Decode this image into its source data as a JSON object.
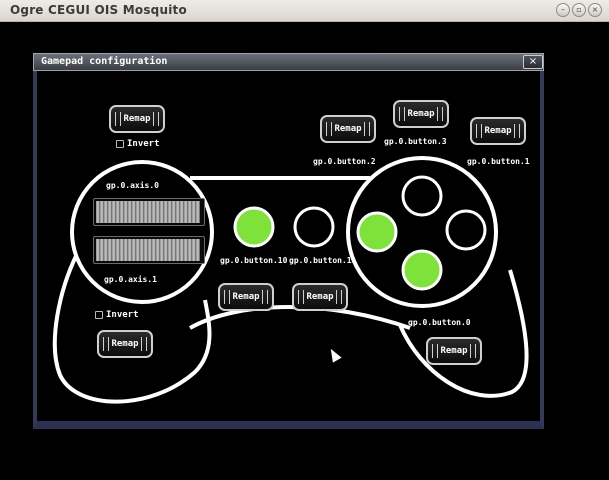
{
  "window": {
    "title": "Ogre CEGUI OIS Mosquito",
    "controls": {
      "minimize": "–",
      "maximize": "▫",
      "close": "×"
    }
  },
  "dialog": {
    "title": "Gamepad configuration",
    "close_icon": "×"
  },
  "remap_label": "Remap",
  "invert_label": "Invert",
  "axes": [
    {
      "label": "gp.0.axis.0",
      "level": 0.98
    },
    {
      "label": "gp.0.axis.1",
      "level": 0.98
    }
  ],
  "buttons": {
    "b0": "gp.0.button.0",
    "b1": "gp.0.button.1",
    "b2": "gp.0.button.2",
    "b3": "gp.0.button.3",
    "b10": "gp.0.button.10",
    "b11": "gp.0.button.11"
  },
  "indicator_states": {
    "b10": true,
    "b11": false,
    "left": true,
    "top": false,
    "right": false,
    "bottom": true
  },
  "colors": {
    "indicator_on": "#7fe23a",
    "indicator_off": "#000000",
    "outline": "#ffffff"
  }
}
